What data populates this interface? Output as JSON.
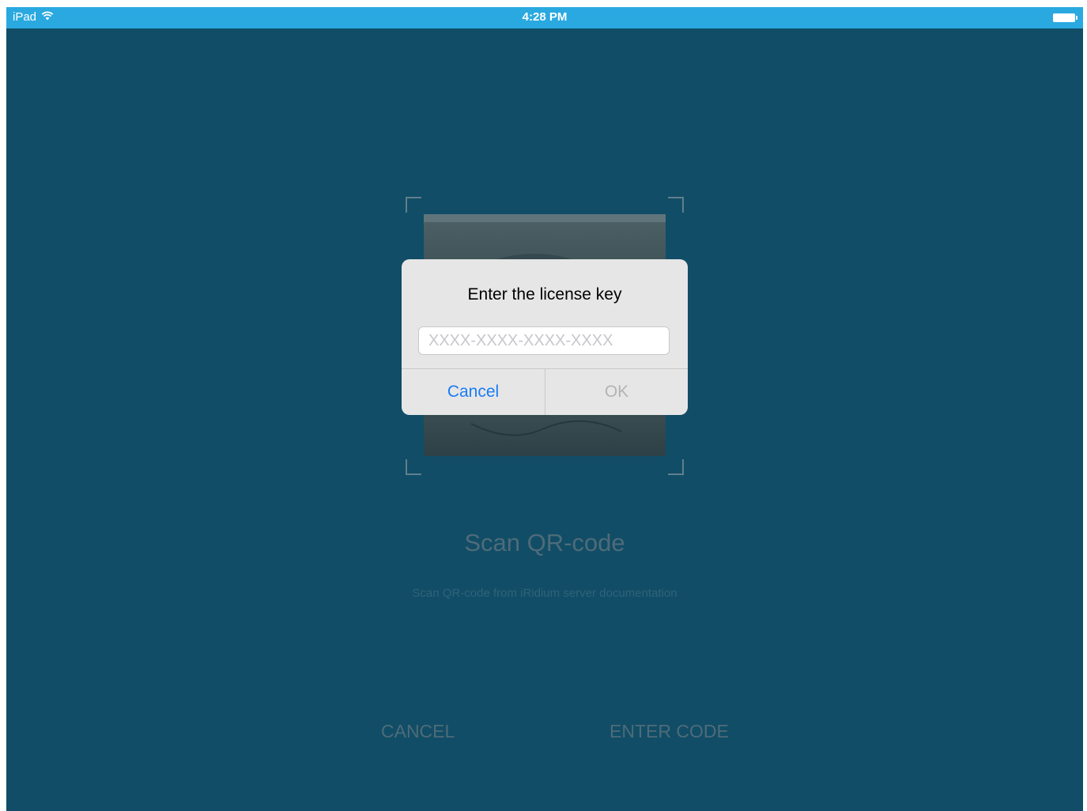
{
  "status_bar": {
    "device": "iPad",
    "time": "4:28 PM",
    "wifi_icon": "wifi-icon",
    "battery_icon": "battery-icon",
    "background": "#29a9e0"
  },
  "scanner": {
    "title": "Scan QR-code",
    "subtitle": "Scan QR-code from iRidium server documentation"
  },
  "bottom_bar": {
    "cancel_label": "CANCEL",
    "enter_code_label": "ENTER CODE"
  },
  "alert": {
    "title": "Enter the license key",
    "input_placeholder": "XXXX-XXXX-XXXX-XXXX",
    "input_value": "",
    "cancel_label": "Cancel",
    "ok_label": "OK",
    "accent": "#1a7cf4"
  },
  "colors": {
    "screen_background": "#114d66"
  }
}
